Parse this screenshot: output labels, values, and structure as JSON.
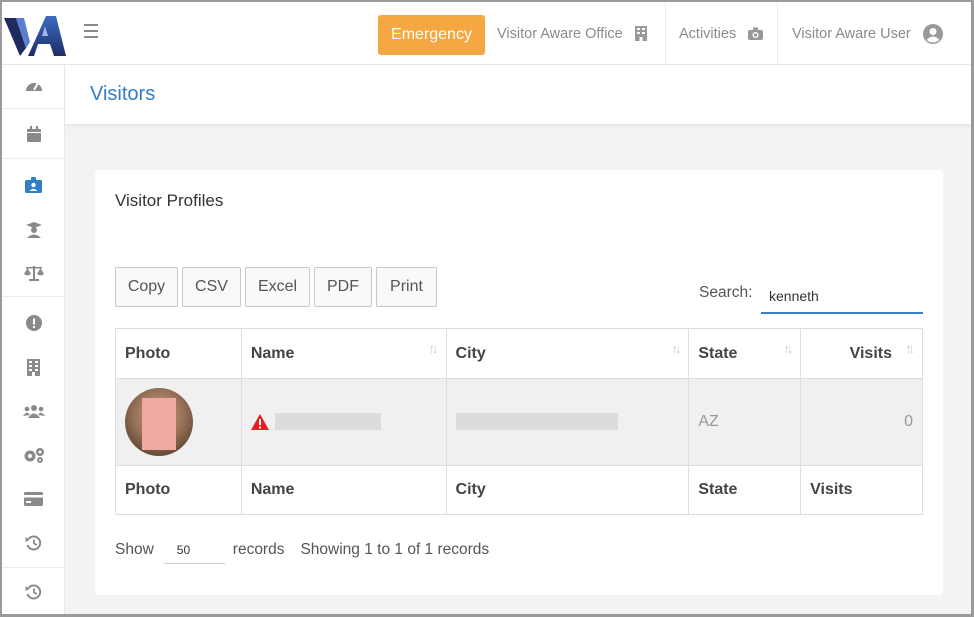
{
  "header": {
    "emergency_label": "Emergency",
    "office_label": "Visitor Aware Office",
    "activities_label": "Activities",
    "user_label": "Visitor Aware User"
  },
  "sidebar": {
    "items": [
      {
        "icon": "dashboard-icon"
      },
      {
        "icon": "calendar-icon"
      },
      {
        "icon": "id-badge-icon",
        "active": true
      },
      {
        "icon": "graduate-icon"
      },
      {
        "icon": "scale-icon"
      },
      {
        "icon": "alert-circle-icon"
      },
      {
        "icon": "building-icon"
      },
      {
        "icon": "users-icon"
      },
      {
        "icon": "gears-icon"
      },
      {
        "icon": "credit-card-icon"
      },
      {
        "icon": "history-icon"
      },
      {
        "icon": "history-icon"
      }
    ]
  },
  "page": {
    "title": "Visitors"
  },
  "card": {
    "title": "Visitor Profiles",
    "buttons": [
      "Copy",
      "CSV",
      "Excel",
      "PDF",
      "Print"
    ],
    "search_label": "Search:",
    "search_value": "kenneth"
  },
  "table": {
    "columns": [
      "Photo",
      "Name",
      "City",
      "State",
      "Visits"
    ],
    "rows": [
      {
        "name": "",
        "city": "",
        "state": "AZ",
        "visits": "0"
      }
    ]
  },
  "footer": {
    "show_label": "Show",
    "page_size": "50",
    "records_label": "records",
    "showing_text": "Showing 1 to 1 of 1 records"
  },
  "colors": {
    "accent": "#2f7ec7",
    "emergency": "#f5a742",
    "warning": "#e02020"
  }
}
